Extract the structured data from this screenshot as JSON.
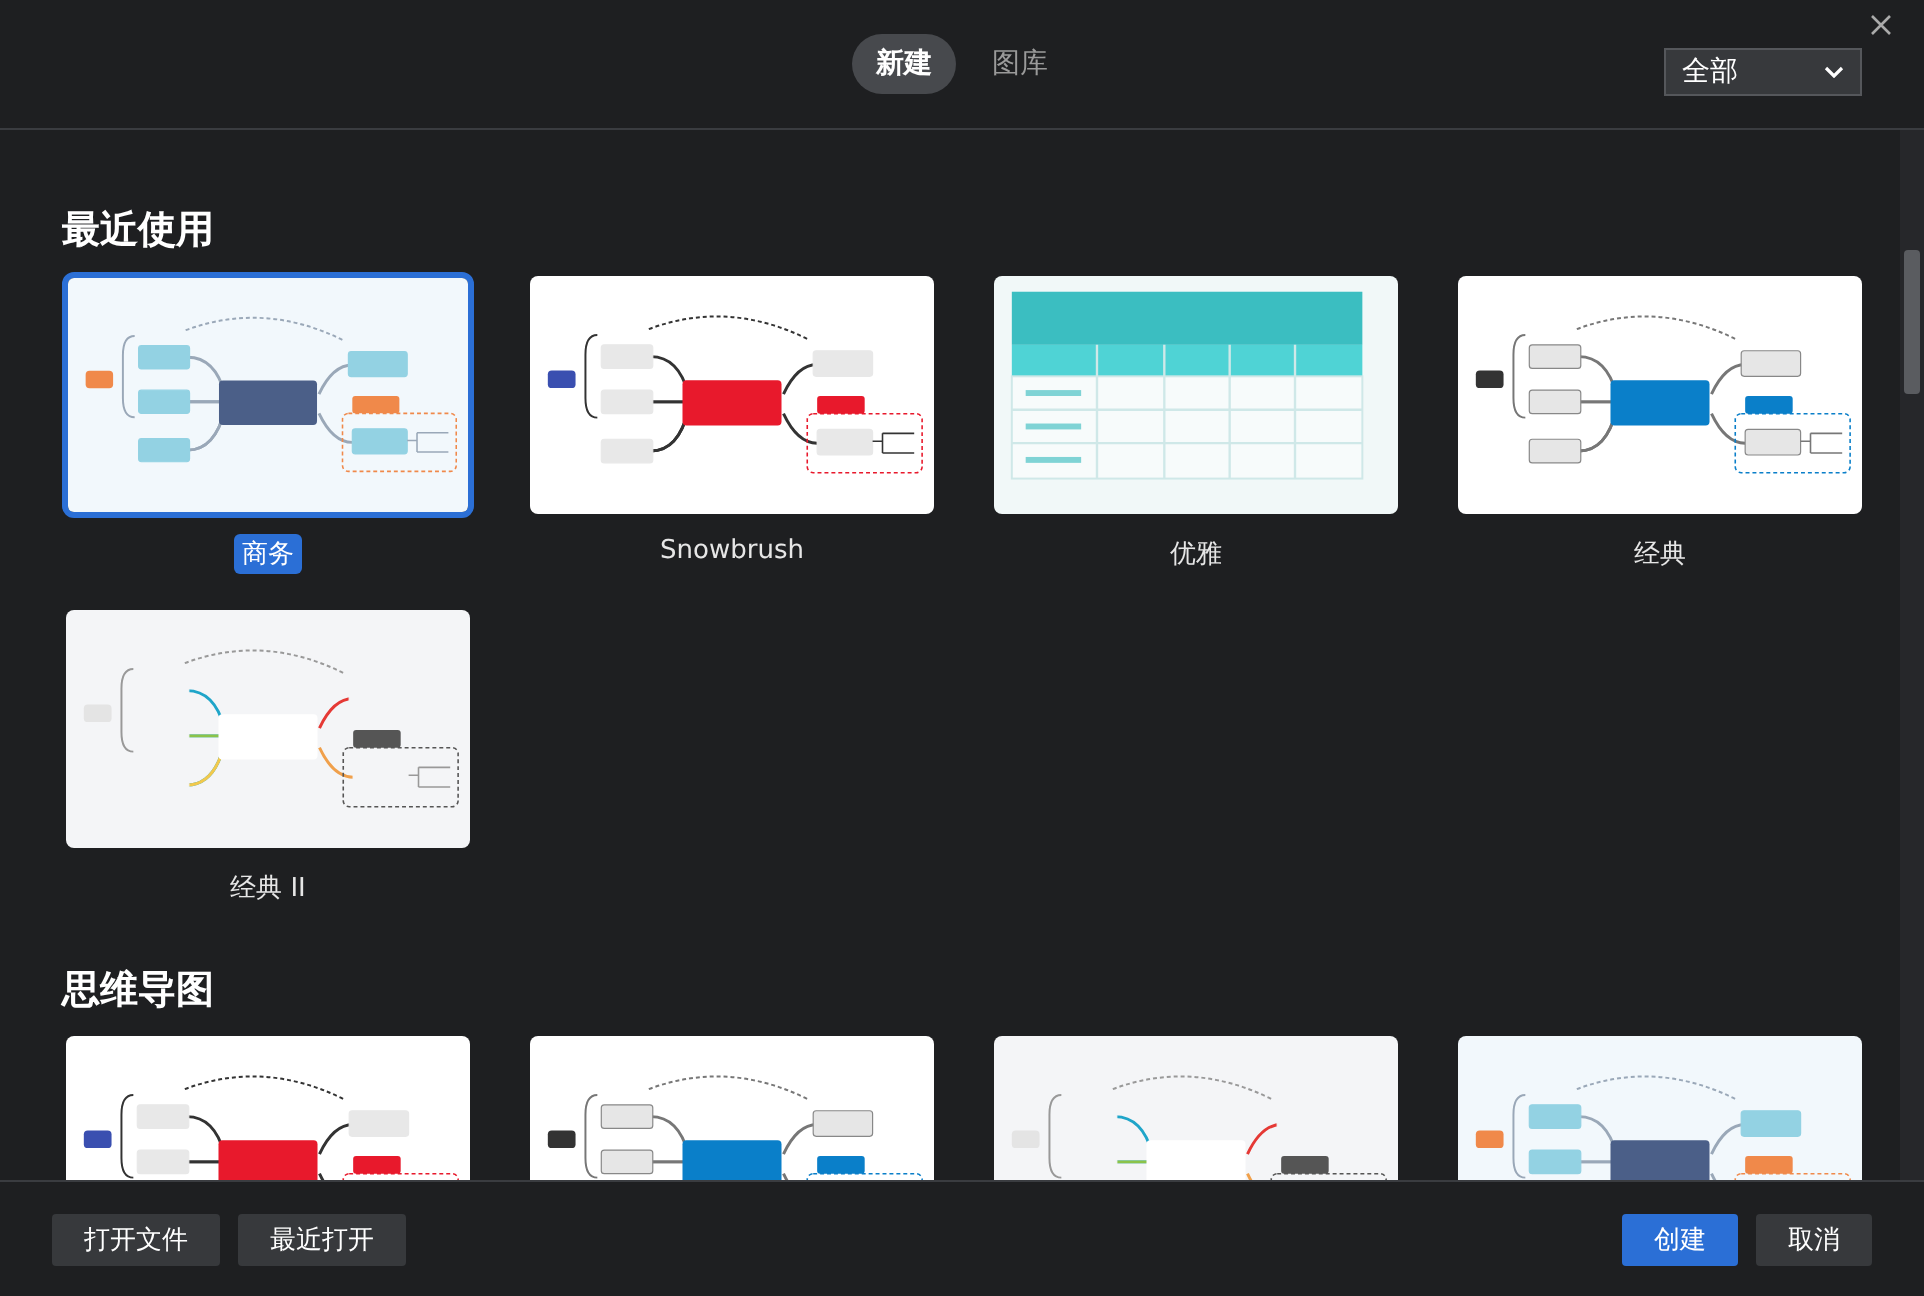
{
  "tabs": [
    {
      "label": "新建",
      "selected": true
    },
    {
      "label": "图库",
      "selected": false
    }
  ],
  "filter": {
    "value": "全部"
  },
  "sections": [
    {
      "title": "最近使用",
      "templates": [
        {
          "name": "商务",
          "selected": true
        },
        {
          "name": "Snowbrush",
          "selected": false
        },
        {
          "name": "优雅",
          "selected": false
        },
        {
          "name": "经典",
          "selected": false
        },
        {
          "name": "经典 II",
          "selected": false
        }
      ]
    },
    {
      "title": "思维导图",
      "templates": [
        {
          "selected": false
        },
        {
          "selected": false
        },
        {
          "selected": false
        },
        {
          "selected": false
        }
      ]
    }
  ],
  "footer": {
    "buttons": [
      {
        "label": "打开文件"
      },
      {
        "label": "最近打开"
      }
    ],
    "actions": [
      {
        "label": "创建",
        "kind": "primary"
      },
      {
        "label": "取消",
        "kind": "secondary"
      }
    ]
  }
}
